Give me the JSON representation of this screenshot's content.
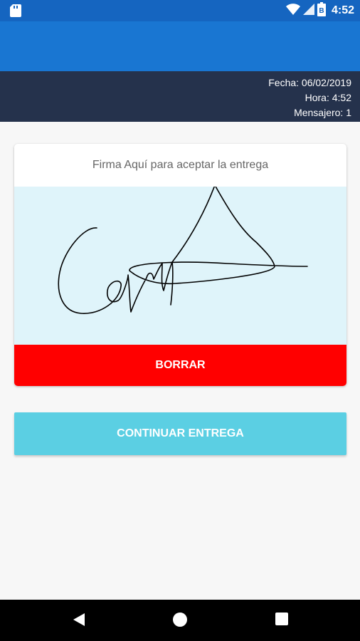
{
  "status_bar": {
    "time": "4:52",
    "icons": [
      "sd-card-icon",
      "wifi-icon",
      "signal-icon",
      "battery-icon"
    ],
    "battery_glyph": "B"
  },
  "info": {
    "fecha": "Fecha: 06/02/2019",
    "hora": "Hora: 4:52",
    "mensajero": "Mensajero: 1"
  },
  "signature_card": {
    "header": "Firma Aquí para aceptar la entrega",
    "clear_button": "BORRAR"
  },
  "continue_button": "CONTINUAR ENTREGA",
  "nav_bar": {
    "icons": [
      "back-icon",
      "home-icon",
      "recents-icon"
    ]
  },
  "colors": {
    "status_bar": "#1565c0",
    "app_bar": "#1976d2",
    "info_bar": "#25324c",
    "signature_pad": "#dff4fa",
    "clear_button": "#ff0000",
    "continue_button": "#5bcfe3"
  }
}
